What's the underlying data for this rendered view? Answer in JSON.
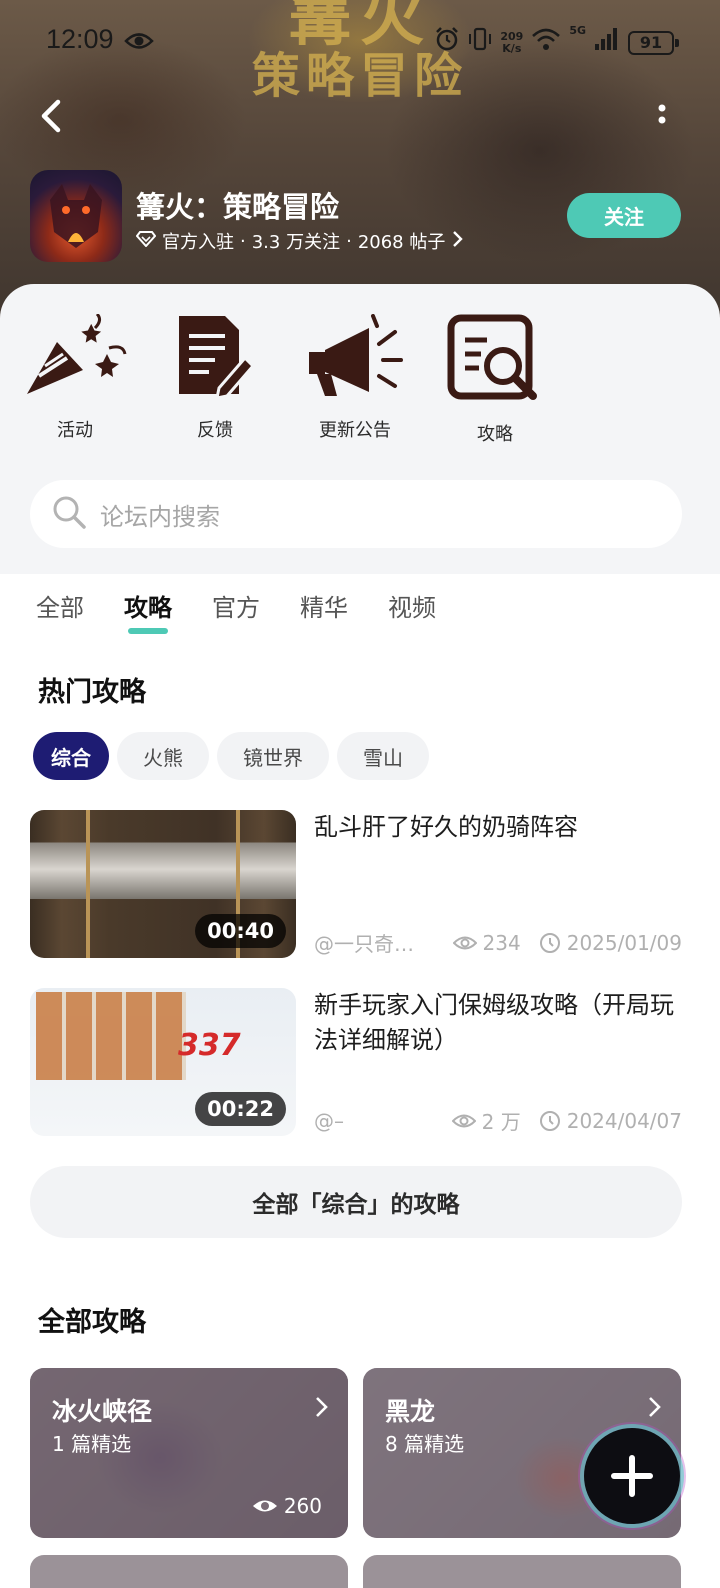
{
  "status_bar": {
    "time": "12:09",
    "net_speed_value": "209",
    "net_speed_unit": "K/s",
    "network": "5G",
    "battery": "91"
  },
  "banner": {
    "art_line1": "篝火",
    "art_line2": "策略冒险"
  },
  "forum": {
    "name": "篝火：策略冒险",
    "badge": "官方入驻",
    "followers": "3.3 万关注",
    "posts": "2068 帖子",
    "follow_label": "关注",
    "separator": "·"
  },
  "shortcuts": [
    {
      "label": "活动",
      "icon": "party-popper-icon"
    },
    {
      "label": "反馈",
      "icon": "document-pen-icon"
    },
    {
      "label": "更新公告",
      "icon": "megaphone-icon"
    },
    {
      "label": "攻略",
      "icon": "guide-search-icon"
    }
  ],
  "search": {
    "placeholder": "论坛内搜索"
  },
  "tabs": [
    {
      "label": "全部",
      "active": false
    },
    {
      "label": "攻略",
      "active": true
    },
    {
      "label": "官方",
      "active": false
    },
    {
      "label": "精华",
      "active": false
    },
    {
      "label": "视频",
      "active": false
    }
  ],
  "hot_guides": {
    "title": "热门攻略",
    "chips": [
      {
        "label": "综合",
        "active": true
      },
      {
        "label": "火熊",
        "active": false
      },
      {
        "label": "镜世界",
        "active": false
      },
      {
        "label": "雪山",
        "active": false
      }
    ],
    "items": [
      {
        "title": "乱斗肝了好久的奶骑阵容",
        "duration": "00:40",
        "author": "@一只奇…",
        "views": "234",
        "date": "2025/01/09"
      },
      {
        "title": "新手玩家入门保姆级攻略（开局玩法详细解说）",
        "duration": "00:22",
        "author": "@–",
        "views": "2 万",
        "date": "2024/04/07",
        "thumb_text": "337"
      }
    ],
    "all_button": "全部「综合」的攻略"
  },
  "all_guides": {
    "title": "全部攻略",
    "cards": [
      {
        "name": "冰火峡径",
        "count": "1 篇精选",
        "views": "260"
      },
      {
        "name": "黑龙",
        "count": "8 篇精选",
        "views": ""
      }
    ]
  },
  "colors": {
    "accent": "#4ec9b5",
    "chip_active": "#1e1c73",
    "icon_brown": "#3a1a14"
  }
}
